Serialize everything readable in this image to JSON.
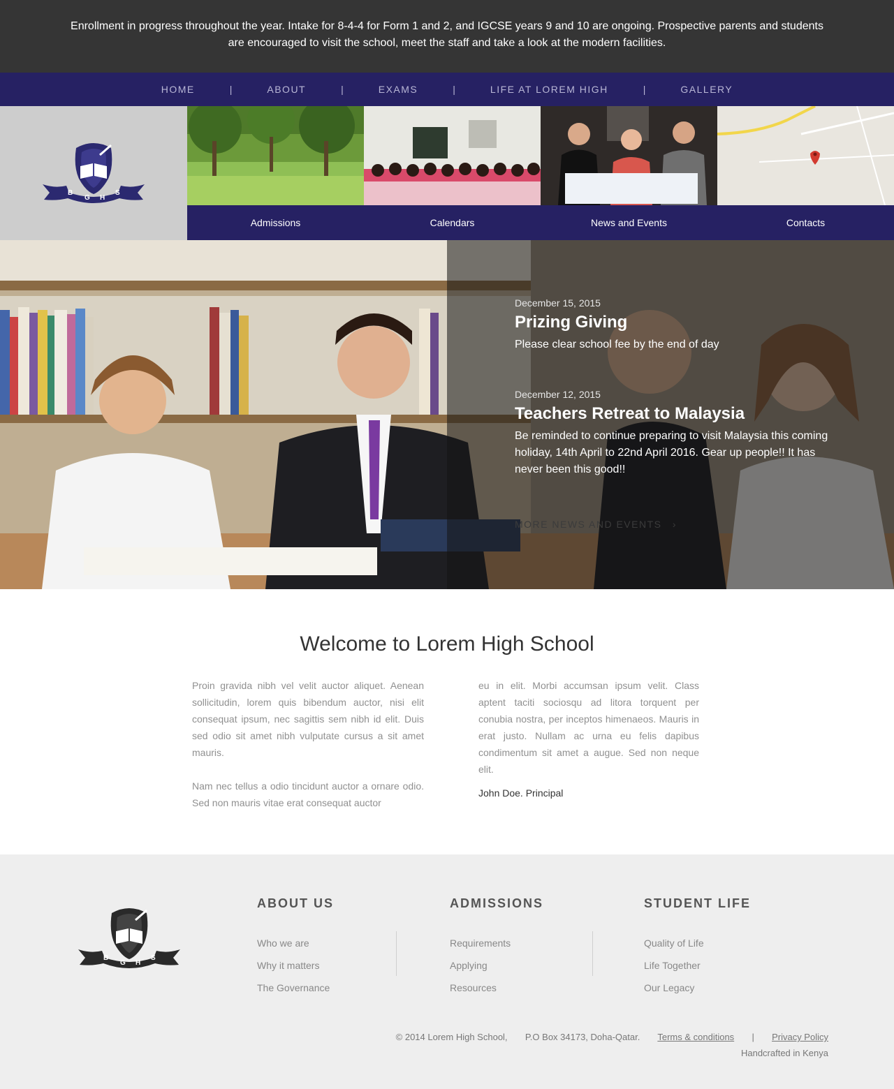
{
  "announcement": "Enrollment in progress throughout the year. Intake for 8-4-4 for Form 1 and 2, and IGCSE years 9 and 10 are ongoing. Prospective parents and students are encouraged to visit the school, meet the staff and take a look at the modern facilities.",
  "nav": {
    "items": [
      "HOME",
      "ABOUT",
      "EXAMS",
      "LIFE AT LOREM HIGH",
      "GALLERY"
    ],
    "separator": "|"
  },
  "logo": {
    "letters": [
      "B",
      "G",
      "H",
      "S"
    ]
  },
  "quick_links": [
    {
      "label": "Admissions"
    },
    {
      "label": "Calendars"
    },
    {
      "label": "News and Events"
    },
    {
      "label": "Contacts"
    }
  ],
  "news": [
    {
      "date": "December 15, 2015",
      "title": "Prizing Giving",
      "body": "Please clear school fee by the end of day"
    },
    {
      "date": "December 12, 2015",
      "title": "Teachers Retreat to Malaysia",
      "body": "Be reminded to continue preparing to visit Malaysia this coming holiday, 14th April to 22nd April 2016. Gear up people!! It has never been this good!!"
    }
  ],
  "more_news": "MORE NEWS AND EVENTS",
  "welcome": {
    "title": "Welcome to Lorem High School",
    "col1_p1": "Proin gravida nibh vel velit auctor aliquet. Aenean sollicitudin, lorem quis bibendum auctor, nisi elit consequat ipsum, nec sagittis sem nibh id elit. Duis sed odio sit amet nibh vulputate cursus a sit amet mauris.",
    "col1_p2": "Nam nec tellus a odio tincidunt auctor a ornare odio. Sed non  mauris vitae erat consequat auctor",
    "col2_p1": "eu in elit. Morbi accumsan ipsum velit. Class aptent taciti sociosqu ad litora torquent per conubia nostra, per inceptos himenaeos. Mauris in erat justo. Nullam ac urna eu felis dapibus condimentum sit amet a augue. Sed non neque elit.",
    "signature": "John Doe. Principal"
  },
  "footer": {
    "columns": [
      {
        "heading": "ABOUT US",
        "links": [
          "Who we are",
          "Why it matters",
          "The Governance"
        ]
      },
      {
        "heading": "ADMISSIONS",
        "links": [
          "Requirements",
          "Applying",
          "Resources"
        ]
      },
      {
        "heading": "STUDENT LIFE",
        "links": [
          "Quality of Life",
          "Life Together",
          "Our Legacy"
        ]
      }
    ],
    "copyright": "© 2014 Lorem High School,",
    "address": "P.O Box 34173, Doha-Qatar.",
    "terms": "Terms & conditions",
    "divider": "|",
    "privacy": "Privacy Policy",
    "crafted": "Handcrafted in Kenya"
  },
  "colors": {
    "announcement_bg": "#353535",
    "nav_bg": "#262163",
    "footer_bg": "#eeeeee"
  }
}
